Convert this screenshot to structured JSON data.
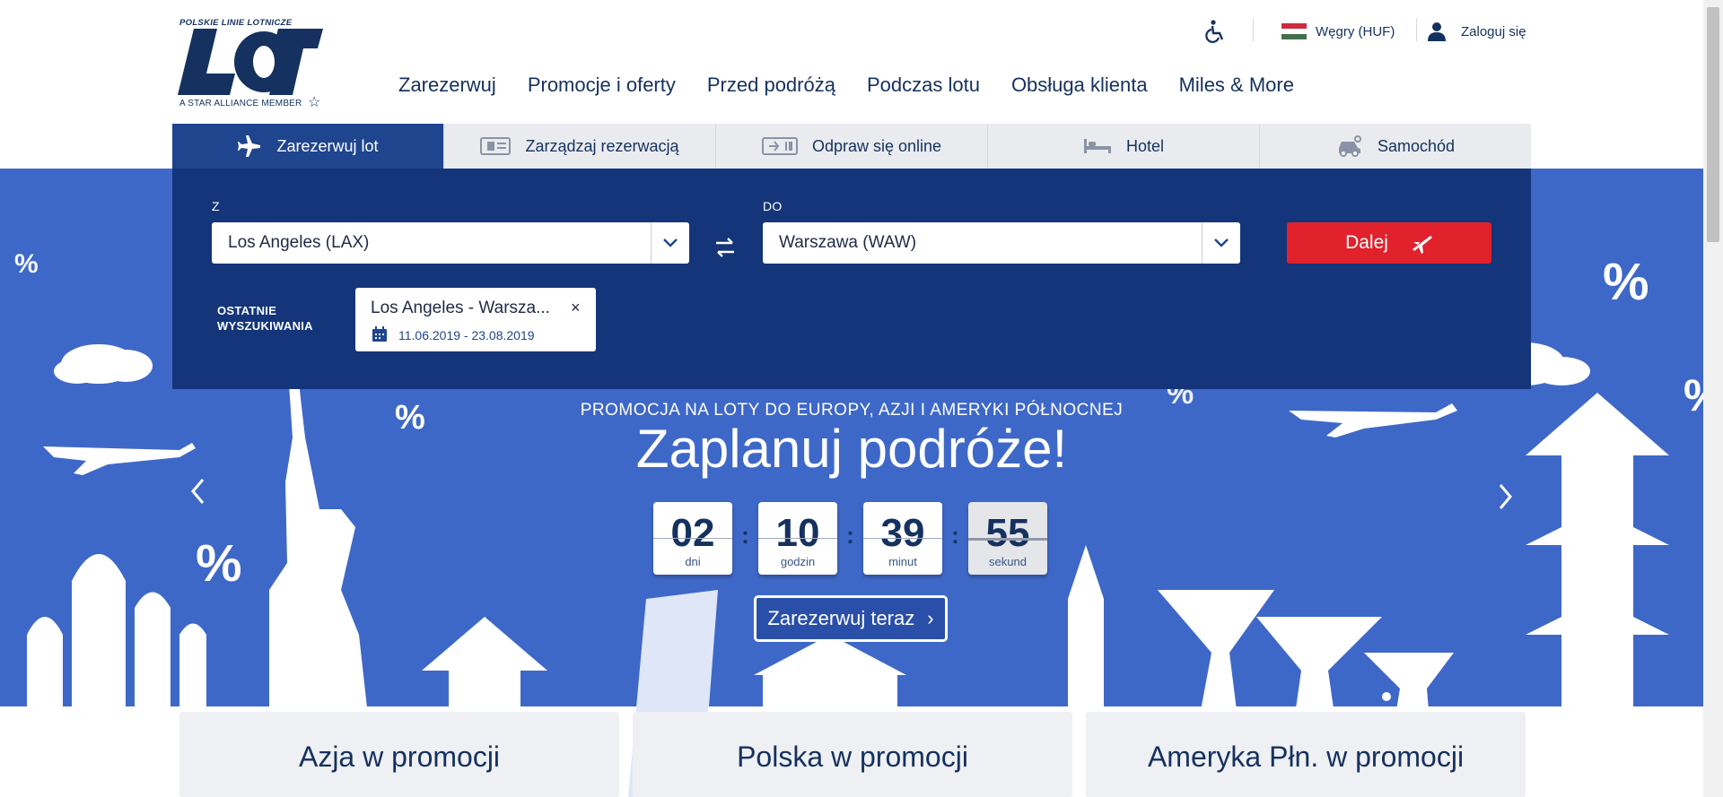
{
  "brand": {
    "top_text": "POLSKIE LINIE LOTNICZE",
    "name": "LOT",
    "bottom_text": "A STAR ALLIANCE MEMBER",
    "color": "#15315f"
  },
  "utility": {
    "accessibility_icon": "wheelchair-icon",
    "country": "Węgry (HUF)",
    "login": "Zaloguj się"
  },
  "nav": {
    "items": [
      "Zarezerwuj",
      "Promocje i oferty",
      "Przed podróżą",
      "Podczas lotu",
      "Obsługa klienta",
      "Miles & More"
    ]
  },
  "tabs": [
    {
      "label": "Zarezerwuj lot",
      "icon": "plane-icon",
      "active": true
    },
    {
      "label": "Zarządzaj rezerwacją",
      "icon": "ticket-icon",
      "active": false
    },
    {
      "label": "Odpraw się online",
      "icon": "boarding-pass-icon",
      "active": false
    },
    {
      "label": "Hotel",
      "icon": "bed-icon",
      "active": false
    },
    {
      "label": "Samochód",
      "icon": "car-icon",
      "active": false
    }
  ],
  "booking": {
    "from_label": "Z",
    "from_value": "Los Angeles (LAX)",
    "to_label": "DO",
    "to_value": "Warszawa (WAW)",
    "submit_label": "Dalej",
    "recent_label_line1": "OSTATNIE",
    "recent_label_line2": "WYSZUKIWANIA",
    "recent": {
      "route": "Los Angeles - Warsza...",
      "dates": "11.06.2019 - 23.08.2019",
      "close": "×"
    }
  },
  "promo": {
    "subtitle": "PROMOCJA NA LOTY DO EUROPY, AZJI I AMERYKI PÓŁNOCNEJ",
    "title": "Zaplanuj podróże!",
    "countdown": [
      {
        "value": "02",
        "unit": "dni"
      },
      {
        "value": "10",
        "unit": "godzin"
      },
      {
        "value": "39",
        "unit": "minut"
      },
      {
        "value": "55",
        "unit": "sekund"
      }
    ],
    "colon": ":",
    "cta": "Zarezerwuj teraz",
    "cta_chevron": "›"
  },
  "cards": [
    "Azja w promocji",
    "Polska w promocji",
    "Ameryka Płn. w promocji"
  ],
  "colors": {
    "hero": "#3e68c8",
    "panel": "#14357a",
    "active_tab": "#1e458e",
    "cta_red": "#e1212b"
  }
}
